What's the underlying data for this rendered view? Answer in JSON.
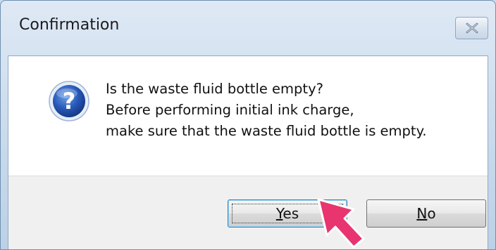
{
  "window": {
    "title": "Confirmation",
    "close_icon": "close-icon"
  },
  "message": {
    "icon": "question-icon",
    "lines": [
      "Is the waste fluid bottle empty?",
      "Before performing initial ink charge,",
      "make sure that the waste fluid bottle is empty."
    ]
  },
  "buttons": {
    "yes": {
      "mnemonic": "Y",
      "rest": "es"
    },
    "no": {
      "mnemonic": "N",
      "rest": "o"
    }
  },
  "annotation": {
    "icon": "pointer-arrow-icon",
    "color": "#e8346f"
  },
  "colors": {
    "titlebar": "#c7d9ec",
    "dialog_body": "#ffffff",
    "button_bar": "#f0f0f0",
    "default_button_border": "#3c7fb1"
  }
}
